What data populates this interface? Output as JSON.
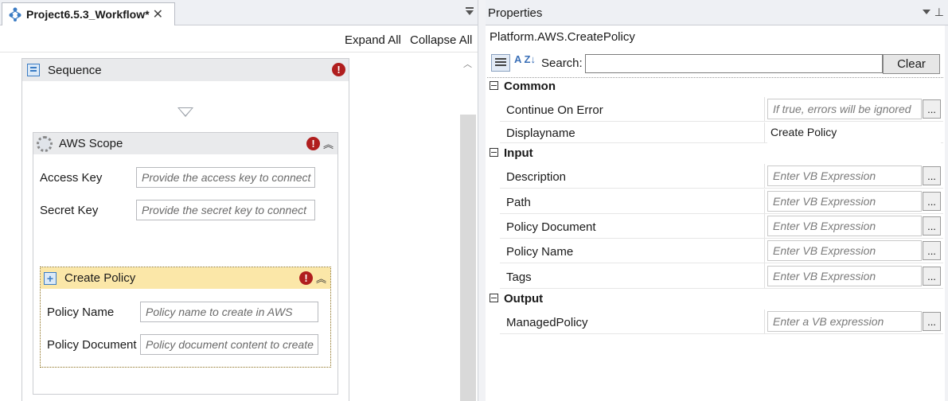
{
  "designer": {
    "tab_title": "Project6.5.3_Workflow*",
    "tab_close": "✕",
    "expand_all": "Expand All",
    "collapse_all": "Collapse All",
    "sequence": {
      "title": "Sequence",
      "error_icon": "!"
    },
    "aws_scope": {
      "title": "AWS Scope",
      "error_icon": "!",
      "collapse_glyph": "︽",
      "fields": [
        {
          "label": "Access Key",
          "placeholder": "Provide the access key to connect"
        },
        {
          "label": "Secret Key",
          "placeholder": "Provide the secret key to connect"
        }
      ]
    },
    "create_policy": {
      "title": "Create Policy",
      "error_icon": "!",
      "collapse_glyph": "︽",
      "expand_glyph": "+",
      "fields": [
        {
          "label": "Policy Name",
          "placeholder": "Policy name to create in AWS"
        },
        {
          "label": "Policy Document",
          "placeholder": "Policy document content to create"
        }
      ]
    }
  },
  "properties": {
    "panel_title": "Properties",
    "pin_glyph": "📌",
    "activity": "Platform.AWS.CreatePolicy",
    "sort_glyph": "A Z↓",
    "search_label": "Search:",
    "search_value": "",
    "clear_label": "Clear",
    "ellipsis": "...",
    "categories": [
      {
        "name": "Common",
        "props": [
          {
            "name": "Continue On Error",
            "value": "If true, errors will be ignored",
            "placeholder": true,
            "has_button": true
          },
          {
            "name": "Displayname",
            "value": "Create Policy",
            "placeholder": false,
            "has_button": false
          }
        ]
      },
      {
        "name": "Input",
        "props": [
          {
            "name": "Description",
            "value": "Enter VB Expression",
            "placeholder": true,
            "has_button": true
          },
          {
            "name": "Path",
            "value": "Enter VB Expression",
            "placeholder": true,
            "has_button": true
          },
          {
            "name": "Policy Document",
            "value": "Enter VB Expression",
            "placeholder": true,
            "has_button": true
          },
          {
            "name": "Policy Name",
            "value": "Enter VB Expression",
            "placeholder": true,
            "has_button": true
          },
          {
            "name": "Tags",
            "value": "Enter VB Expression",
            "placeholder": true,
            "has_button": true
          }
        ]
      },
      {
        "name": "Output",
        "props": [
          {
            "name": "ManagedPolicy",
            "value": "Enter a VB expression",
            "placeholder": true,
            "has_button": true
          }
        ]
      }
    ]
  },
  "colors": {
    "error_red": "#b01e1e",
    "selected_activity_header": "#fbe7a8",
    "header_gray": "#e9eaec",
    "accent_blue": "#3b7cc4"
  }
}
